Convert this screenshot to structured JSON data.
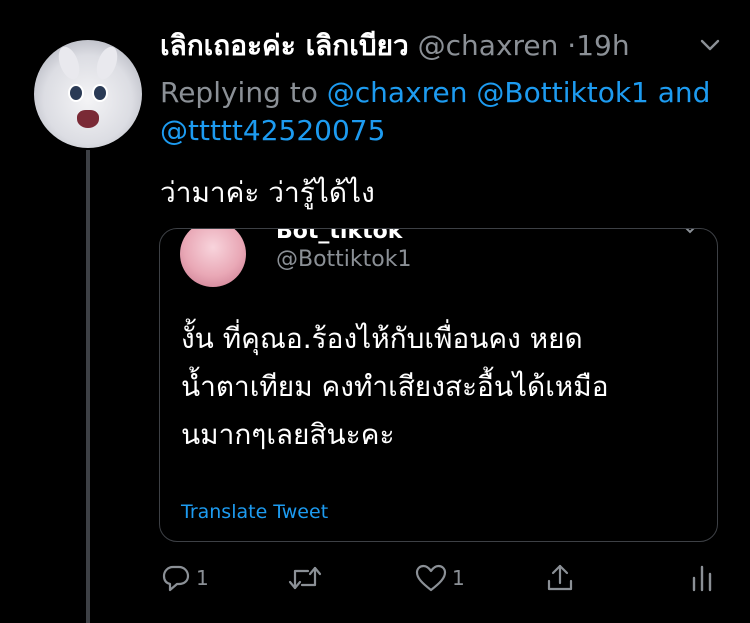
{
  "tweet": {
    "author_name": "เลิกเถอะค่ะ เลิกเบียว",
    "handle": "@chaxren",
    "separator": "·",
    "time": "19h",
    "replying_prefix": "Replying to",
    "mentions": [
      "@chaxren",
      "@Bottiktok1",
      "@ttttt42520075"
    ],
    "mention_joiner": "and",
    "text": "ว่ามาค่ะ ว่ารู้ได้ไง"
  },
  "quote": {
    "author_name": "Bot_tiktok",
    "handle": "@Bottiktok1",
    "lines": [
      "งั้น ที่คุณอ.ร้องไห้กับเพื่อนคง หยด",
      "น้ำตาเทียม คงทำเสียงสะอื้นได้เหมือ",
      "นมากๆเลยสินะคะ"
    ],
    "translate_label": "Translate Tweet"
  },
  "actions": {
    "reply_count": "1",
    "like_count": "1"
  },
  "colors": {
    "background": "#000000",
    "text": "#ffffff",
    "muted": "#8b9096",
    "accent": "#1d9bf0",
    "border": "#3d4045"
  },
  "icons": {
    "avatar": "white-rabbit-avatar",
    "quote_avatar": "pink-anime-avatar",
    "caret": "chevron-down-icon",
    "reply": "reply-icon",
    "retweet": "retweet-icon",
    "like": "heart-icon",
    "share": "share-icon",
    "analytics": "analytics-icon"
  }
}
